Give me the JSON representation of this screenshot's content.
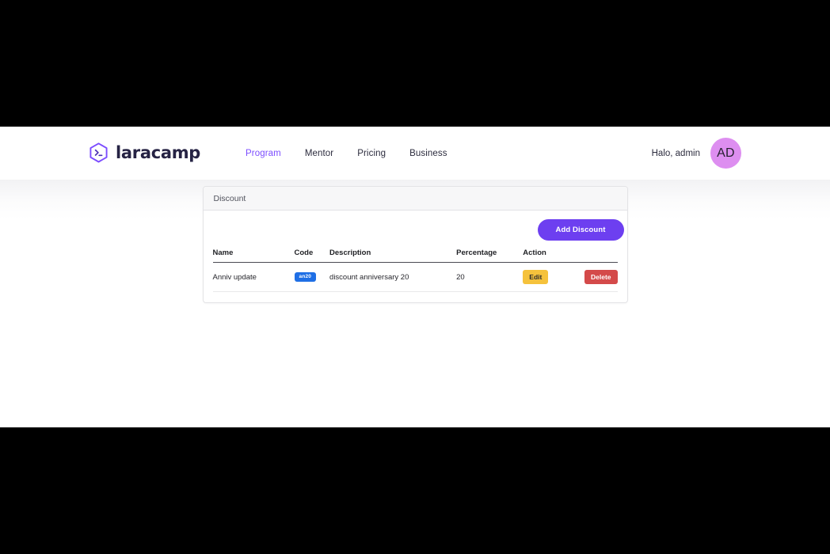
{
  "brand": {
    "name": "laracamp",
    "logo_icon": "hexagon-terminal-icon",
    "accent_color": "#7c4dff"
  },
  "nav": {
    "items": [
      {
        "label": "Program",
        "active": true
      },
      {
        "label": "Mentor",
        "active": false
      },
      {
        "label": "Pricing",
        "active": false
      },
      {
        "label": "Business",
        "active": false
      }
    ]
  },
  "user": {
    "greeting": "Halo, admin",
    "avatar_initials": "AD",
    "avatar_color": "#dd8ef0"
  },
  "card": {
    "title": "Discount",
    "add_button_label": "Add Discount",
    "add_button_color": "#6d3ff0"
  },
  "table": {
    "columns": [
      "Name",
      "Code",
      "Description",
      "Percentage",
      "Action"
    ],
    "rows": [
      {
        "name": "Anniv update",
        "code": "an20",
        "code_badge_color": "#1f6fe5",
        "description": "discount anniversary 20",
        "percentage": "20",
        "edit_label": "Edit",
        "edit_color": "#f5c23c",
        "delete_label": "Delete",
        "delete_color": "#d44a4a"
      }
    ]
  }
}
